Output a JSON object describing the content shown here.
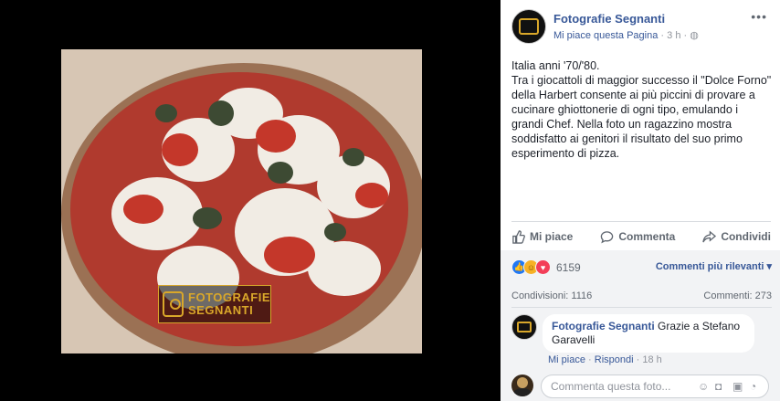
{
  "post": {
    "page_name": "Fotografie Segnanti",
    "like_page_link": "Mi piace questa Pagina",
    "time_ago": "· 3 h ·",
    "privacy_icon": "globe-icon",
    "more_label": "•••",
    "text_lines": [
      "Italia anni '70/'80.",
      "Tra i giocattoli di maggior successo il \"Dolce Forno\" della Harbert consente ai più piccini di provare a cucinare ghiottonerie di ogni tipo, emulando i grandi Chef. Nella foto un ragazzino mostra soddisfatto ai genitori il risultato del suo primo esperimento di pizza."
    ]
  },
  "photo": {
    "watermark_line1": "FOTOGRAFIE",
    "watermark_line2": "SEGNANTI"
  },
  "actions": {
    "like": "Mi piace",
    "comment": "Commenta",
    "share": "Condividi"
  },
  "reactions": {
    "count": "6159",
    "types": [
      "like",
      "haha",
      "love"
    ],
    "sort_label": "Commenti più rilevanti ▾"
  },
  "stats": {
    "shares": "Condivisioni: 1116",
    "comments": "Commenti: 273"
  },
  "comment": {
    "author": "Fotografie Segnanti",
    "text": "Grazie a Stefano Garavelli",
    "like_label": "Mi piace",
    "reply_label": "Rispondi",
    "time": "18 h"
  },
  "composer": {
    "placeholder": "Commenta questa foto...",
    "icons": [
      "emoji-icon",
      "camera-icon",
      "gif-icon",
      "sticker-icon"
    ]
  },
  "colors": {
    "link": "#385898",
    "like_blue": "#2078f4",
    "love_red": "#f33e58",
    "haha_yellow": "#f7b125",
    "watermark_gold": "#d9a72a"
  }
}
